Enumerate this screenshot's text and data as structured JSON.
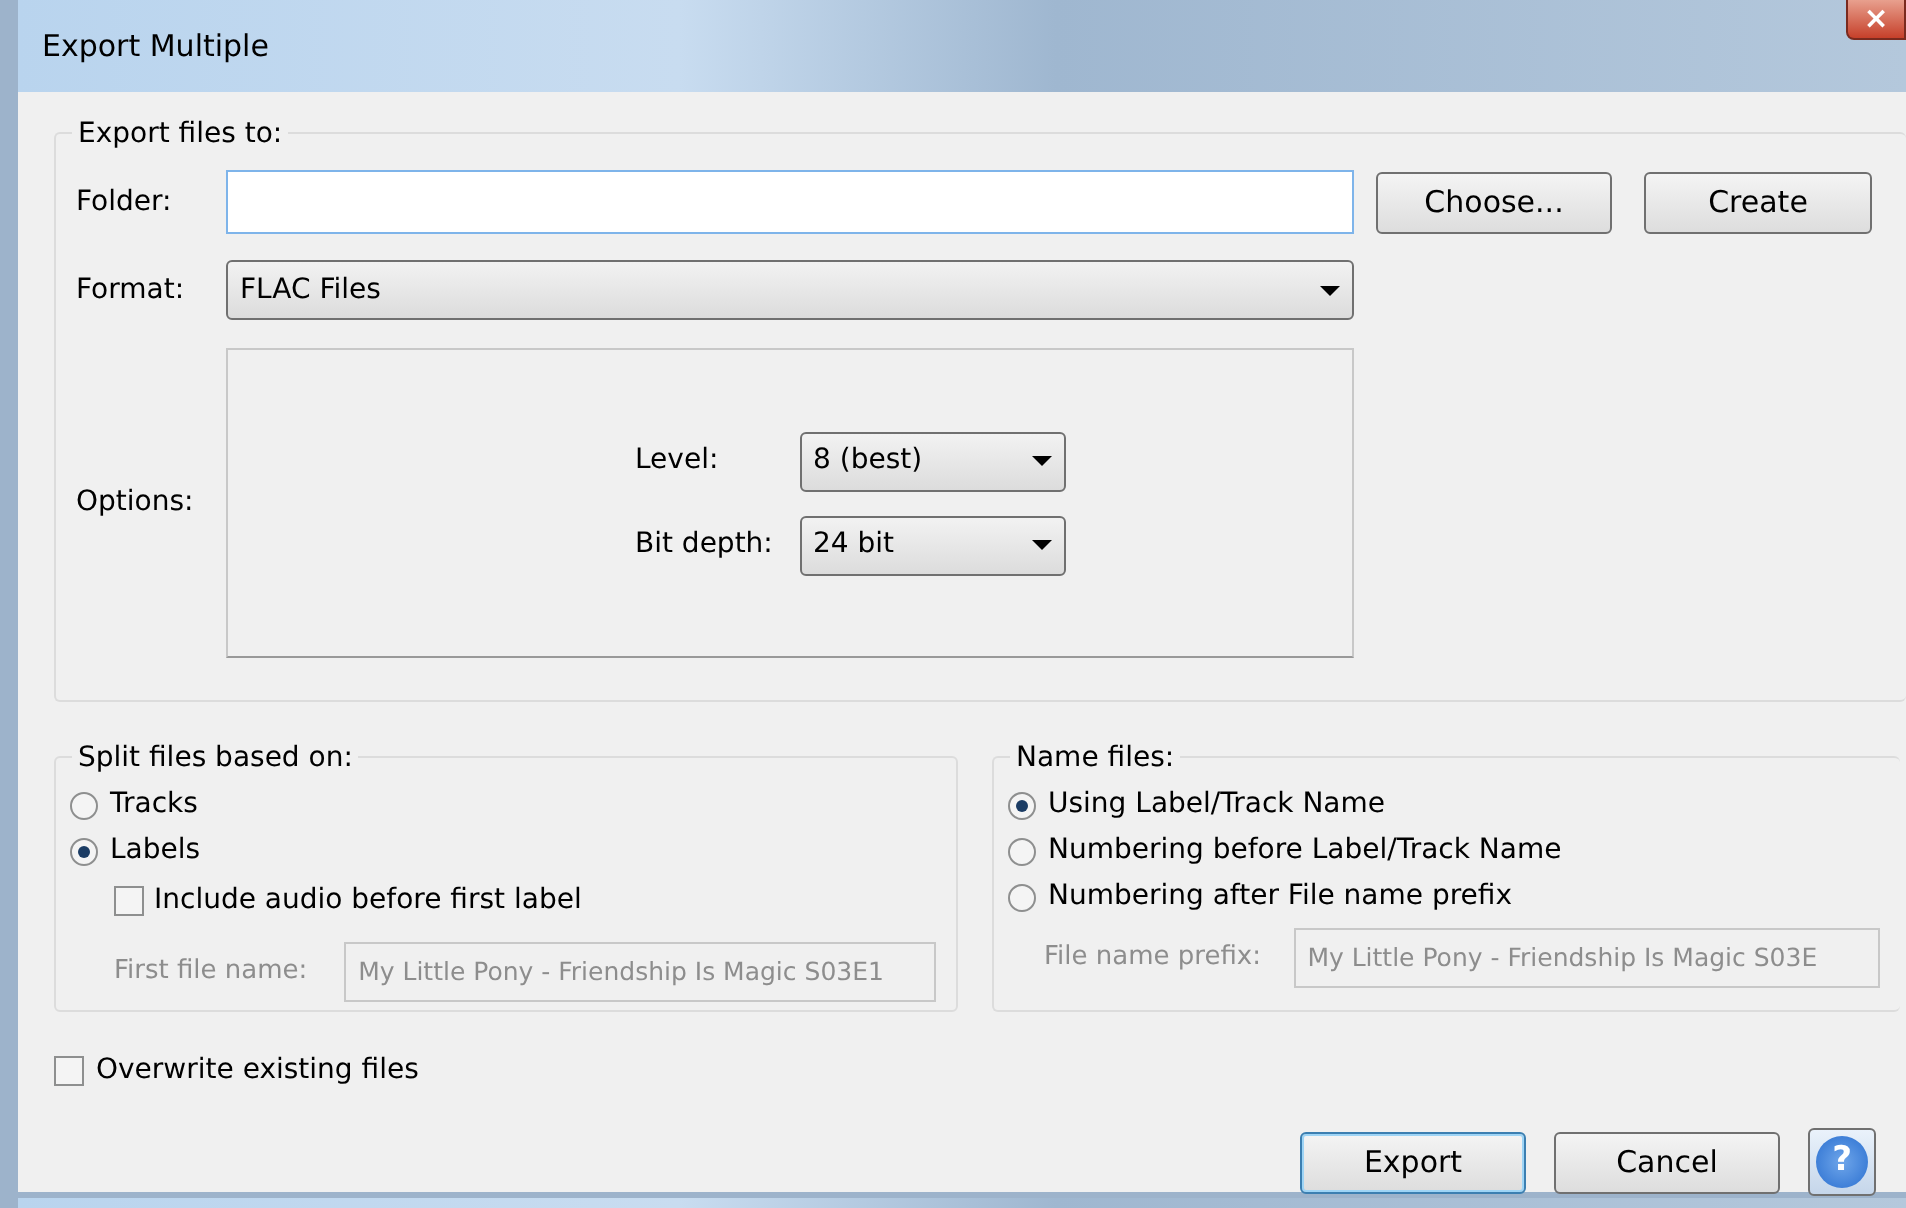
{
  "window": {
    "title": "Export Multiple",
    "close": "×"
  },
  "export_to": {
    "legend": "Export files to:",
    "folder": {
      "label": "Folder:"
    },
    "choose": "Choose...",
    "create": "Create",
    "format": {
      "label": "Format:",
      "value": "FLAC Files"
    },
    "options": {
      "label": "Options:",
      "fields": [
        {
          "label": "Level:",
          "value": "8 (best)"
        },
        {
          "label": "Bit depth:",
          "value": "24 bit"
        }
      ]
    }
  },
  "split": {
    "legend": "Split files based on:",
    "choices": [
      {
        "label": "Tracks",
        "selected": false
      },
      {
        "label": "Labels",
        "selected": true
      }
    ],
    "include_audio": {
      "label": "Include audio before first label",
      "checked": false
    },
    "first_file_name": {
      "label": "First file name:",
      "value": "My Little Pony - Friendship Is Magic S03E1",
      "disabled": true
    }
  },
  "name_files": {
    "legend": "Name files:",
    "choices": [
      {
        "label": "Using Label/Track Name",
        "selected": true
      },
      {
        "label": "Numbering before Label/Track Name",
        "selected": false
      },
      {
        "label": "Numbering after File name prefix",
        "selected": false
      }
    ],
    "prefix": {
      "label": "File name prefix:",
      "value": "My Little Pony - Friendship Is Magic S03E",
      "disabled": true
    }
  },
  "overwrite": {
    "label": "Overwrite existing files",
    "checked": false
  },
  "buttons": [
    {
      "label": "Export",
      "kind": "default"
    },
    {
      "label": "Cancel",
      "kind": "normal"
    },
    {
      "label": "?",
      "kind": "help"
    }
  ]
}
